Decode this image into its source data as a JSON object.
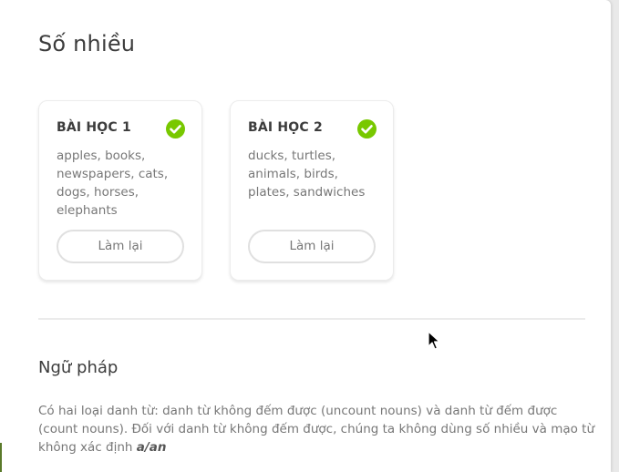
{
  "page": {
    "title": "Số nhiều"
  },
  "lessons": [
    {
      "title": "BÀI HỌC 1",
      "words": "apples, books, newspapers, cats, dogs, horses, elephants",
      "button_label": "Làm lại",
      "completed": true
    },
    {
      "title": "BÀI HỌC 2",
      "words": "ducks, turtles, animals, birds, plates, sandwiches",
      "button_label": "Làm lại",
      "completed": true
    }
  ],
  "grammar": {
    "title": "Ngữ pháp",
    "text": "Có hai loại danh từ: danh từ không đếm được (uncount nouns) và danh từ đếm được (count nouns). Đối với danh từ không đếm được, chúng ta không dùng số nhiều và mạo từ không xác định",
    "emphasis": "a/an"
  },
  "colors": {
    "check_green": "#78c800",
    "text_dark": "#3c3c3c",
    "text_muted": "#777777"
  },
  "icons": {
    "completed": "check-circle-icon",
    "cursor": "mouse-pointer-icon"
  }
}
